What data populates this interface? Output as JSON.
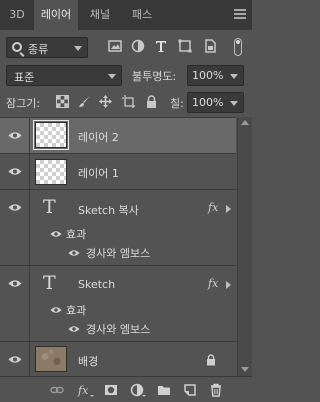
{
  "tabs": [
    {
      "label": "3D",
      "active": false
    },
    {
      "label": "레이어",
      "active": true
    },
    {
      "label": "채널",
      "active": false
    },
    {
      "label": "패스",
      "active": false
    }
  ],
  "filter": {
    "kind_label": "종류"
  },
  "blend_mode": "표준",
  "opacity": {
    "label": "불투명도:",
    "value": "100%"
  },
  "lock": {
    "label": "잠그기:"
  },
  "fill": {
    "label": "칠:",
    "value": "100%"
  },
  "layers": [
    {
      "name": "레이어 2",
      "type": "pixel",
      "selected": true
    },
    {
      "name": "레이어 1",
      "type": "pixel",
      "selected": false
    },
    {
      "name": "Sketch 복사",
      "type": "text",
      "has_fx": true,
      "effects_label": "효과",
      "effects": [
        "경사와 엠보스"
      ]
    },
    {
      "name": "Sketch",
      "type": "text",
      "has_fx": true,
      "effects_label": "효과",
      "effects": [
        "경사와 엠보스"
      ]
    },
    {
      "name": "배경",
      "type": "background",
      "locked": true
    }
  ],
  "icons": {
    "visibility": "eye-icon",
    "text_layer": "T",
    "fx": "fx",
    "footer": [
      "link-icon",
      "fx-icon",
      "mask-icon",
      "adjustment-icon",
      "folder-icon",
      "new-layer-icon",
      "trash-icon"
    ]
  },
  "colors": {
    "panel_bg": "#535353",
    "tabbar_bg": "#383838",
    "selected_row": "#696969",
    "text": "#d6d6d6"
  }
}
